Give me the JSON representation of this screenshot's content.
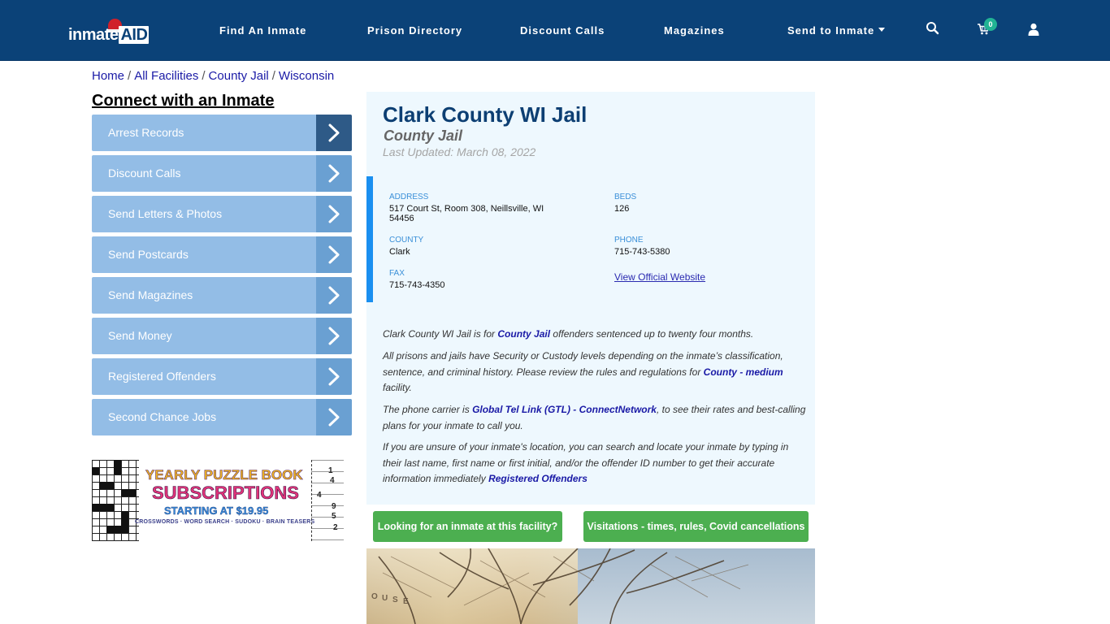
{
  "header": {
    "logo_text": "inmate",
    "logo_text_accent": "AID",
    "nav": [
      {
        "label": "Find An Inmate"
      },
      {
        "label": "Prison Directory"
      },
      {
        "label": "Discount Calls"
      },
      {
        "label": "Magazines"
      },
      {
        "label": "Send to Inmate",
        "has_dropdown": true
      }
    ],
    "icons": [
      "search-icon",
      "cart-icon",
      "user-icon"
    ],
    "cart_count": "0",
    "colors": {
      "background": "#0b4278",
      "badge": "#21b394"
    }
  },
  "breadcrumb": [
    {
      "label": "Home"
    },
    {
      "label": "All Facilities"
    },
    {
      "label": "County Jail"
    },
    {
      "label": "Wisconsin"
    }
  ],
  "sidebar": {
    "title": "Connect with an Inmate",
    "items": [
      {
        "label": "Arrest Records"
      },
      {
        "label": "Discount Calls"
      },
      {
        "label": "Send Letters & Photos"
      },
      {
        "label": "Send Postcards"
      },
      {
        "label": "Send Magazines"
      },
      {
        "label": "Send Money"
      },
      {
        "label": "Registered Offenders"
      },
      {
        "label": "Second Chance Jobs"
      }
    ],
    "ad": {
      "line1": "YEARLY PUZZLE BOOK",
      "line2": "SUBSCRIPTIONS",
      "line3": "STARTING AT $19.95",
      "line4": "CROSSWORDS · WORD SEARCH · SUDOKU · BRAIN TEASERS",
      "sudoku_digits": [
        "1",
        "4",
        "4",
        "9",
        "5",
        "2"
      ]
    }
  },
  "facility": {
    "name": "Clark County WI Jail",
    "type": "County Jail",
    "last_updated": "Last Updated: March 08, 2022",
    "info": {
      "address_label": "ADDRESS",
      "address_line1": "517 Court St, Room 308, Neillsville, WI",
      "address_line2": "54456",
      "beds_label": "BEDS",
      "beds": "126",
      "county_label": "COUNTY",
      "county": "Clark",
      "phone_label": "PHONE",
      "phone": "715-743-5380",
      "fax_label": "FAX",
      "fax": "715-743-4350",
      "website_link": "View Official Website"
    },
    "paragraphs": {
      "p1_pre": "Clark County WI Jail is for ",
      "p1_link": "County Jail",
      "p1_post": " offenders sentenced up to twenty four months.",
      "p2_pre": "All prisons and jails have Security or Custody levels depending on the inmate’s classification, sentence, and criminal history. Please review the rules and regulations for ",
      "p2_link": "County - medium",
      "p2_post": " facility.",
      "p3_pre": "The phone carrier is ",
      "p3_link": "Global Tel Link (GTL) - ConnectNetwork",
      "p3_post": ", to see their rates and best-calling plans for your inmate to call you.",
      "p4_pre": "If you are unsure of your inmate's location, you can search and locate your inmate by typing in their last name, first name or first initial, and/or the offender ID number to get their accurate information immediately ",
      "p4_link": "Registered Offenders"
    },
    "buttons": {
      "find_inmate": "Looking for an inmate at this facility?",
      "visitations": "Visitations - times, rules, Covid cancellations"
    },
    "colors": {
      "title": "#0d3f73",
      "panel_bg": "#eef8fe",
      "accent_bar": "#1a8ff0",
      "button": "#4caf50"
    }
  }
}
